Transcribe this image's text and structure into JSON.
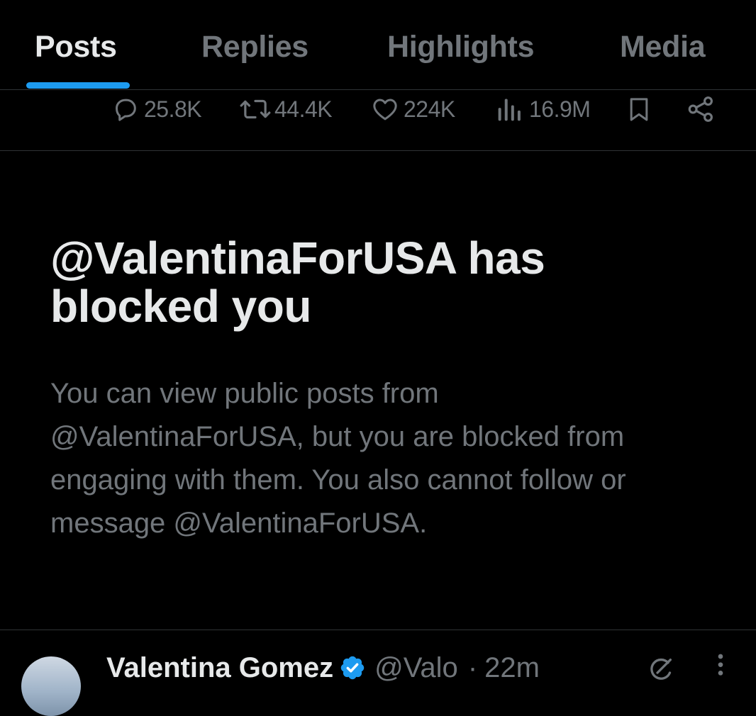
{
  "tabs": [
    {
      "label": "Posts",
      "active": true
    },
    {
      "label": "Replies",
      "active": false
    },
    {
      "label": "Highlights",
      "active": false
    },
    {
      "label": "Media",
      "active": false
    }
  ],
  "actions": {
    "replies": {
      "icon": "reply-icon",
      "count": "25.8K"
    },
    "reposts": {
      "icon": "repost-icon",
      "count": "44.4K"
    },
    "likes": {
      "icon": "heart-icon",
      "count": "224K"
    },
    "views": {
      "icon": "views-icon",
      "count": "16.9M"
    },
    "bookmark": {
      "icon": "bookmark-icon"
    },
    "share": {
      "icon": "share-icon"
    }
  },
  "blocked": {
    "title": "@ValentinaForUSA has blocked you",
    "description": "You can view public posts from @ValentinaForUSA, but you are blocked from engaging with them. You also cannot follow or message @ValentinaForUSA."
  },
  "next_post": {
    "name": "Valentina Gomez",
    "handle": "@Valo",
    "separator": "·",
    "time": "22m",
    "verified_icon": "verified-badge-icon",
    "grok_icon": "grok-icon",
    "more_icon": "more-icon"
  },
  "colors": {
    "background": "#000000",
    "text_primary": "#e7e9ea",
    "text_secondary": "#71767b",
    "accent": "#1d9bf0",
    "divider": "#2f3336"
  }
}
